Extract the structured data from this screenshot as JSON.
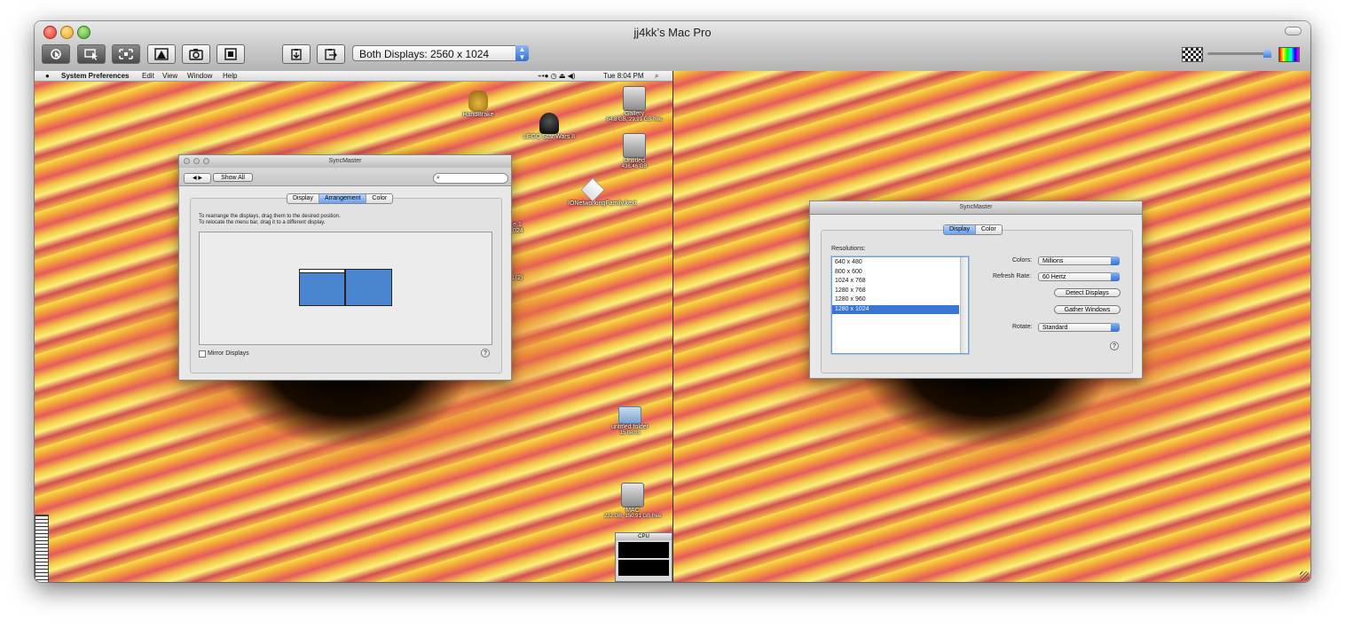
{
  "window": {
    "title": "jj4kk’s Mac Pro",
    "display_selector": "Both Displays: 2560 x 1024",
    "toolbar_icons": [
      "control-icon",
      "share-mouse-icon",
      "fit-screen-icon",
      "full-screen-icon",
      "capture-icon",
      "scale-icon",
      "get-clipboard-icon",
      "send-clipboard-icon"
    ],
    "right_controls": [
      "image-quality-icon",
      "quality-slider",
      "color-icon"
    ]
  },
  "remote_left": {
    "menubar": {
      "apple": "",
      "app": "System Preferences",
      "items": [
        "Edit",
        "View",
        "Window",
        "Help"
      ],
      "clock": "Tue 8:04 PM"
    },
    "desktop_icons": [
      {
        "label": "HandBrake"
      },
      {
        "label": "LEGO Star Wars II"
      },
      {
        "label": "Gallery",
        "sub": "64.8 GB, 29.91 GB free"
      },
      {
        "label": "Untitled",
        "sub": "436.46 GB"
      },
      {
        "label": "IONetworkingFamily.kext"
      },
      {
        "label": "untitled folder",
        "sub": "15 items"
      },
      {
        "label": "MAC",
        "sub": "232 GB, 150.91 GB free"
      }
    ],
    "partial_labels": [
      "e 1",
      ",024",
      "1(2)"
    ],
    "cpu_widget_title": "CPU"
  },
  "arrangement_window": {
    "title": "SyncMaster",
    "show_all": "Show All",
    "tabs": [
      "Display",
      "Arrangement",
      "Color"
    ],
    "active_tab": "Arrangement",
    "instructions": [
      "To rearrange the displays, drag them to the desired position.",
      "To relocate the menu bar, drag it to a different display."
    ],
    "mirror_label": "Mirror Displays",
    "mirror_checked": false
  },
  "display_window": {
    "title": "SyncMaster",
    "tabs": [
      "Display",
      "Color"
    ],
    "active_tab": "Display",
    "resolutions_label": "Resolutions:",
    "resolutions": [
      "640 x 480",
      "800 x 600",
      "1024 x 768",
      "1280 x 768",
      "1280 x 960",
      "1280 x 1024"
    ],
    "selected_resolution": "1280 x 1024",
    "colors_label": "Colors:",
    "colors_value": "Millions",
    "refresh_label": "Refresh Rate:",
    "refresh_value": "60 Hertz",
    "detect_button": "Detect Displays",
    "gather_button": "Gather Windows",
    "rotate_label": "Rotate:",
    "rotate_value": "Standard"
  },
  "colors": {
    "accent_blue": "#3875d7",
    "display_block": "#4a86cf"
  }
}
